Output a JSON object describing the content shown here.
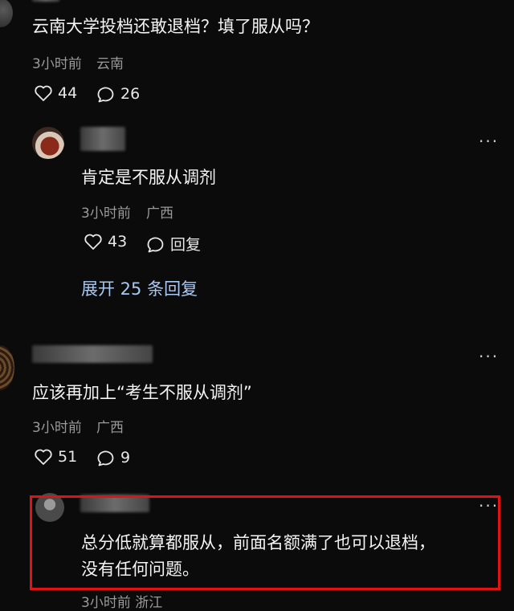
{
  "comments": [
    {
      "text": "云南大学投档还敢退档？填了服从吗？",
      "time": "3小时前",
      "location": "云南",
      "likes": "44",
      "replies": "26"
    },
    {
      "text": "肯定是不服从调剂",
      "time": "3小时前",
      "location": "广西",
      "likes": "43",
      "reply_label": "回复",
      "expand_label": "展开 25 条回复"
    },
    {
      "text": "应该再加上“考生不服从调剂”",
      "time": "3小时前",
      "location": "广西",
      "likes": "51",
      "replies": "9"
    },
    {
      "text_line1": "总分低就算都服从，前面名额满了也可以退档，",
      "text_line2": "没有任何问题。",
      "time_partial": "3小时前 浙江"
    }
  ],
  "menu_icon": "more-dots-icon",
  "highlight_color": "#e01212"
}
